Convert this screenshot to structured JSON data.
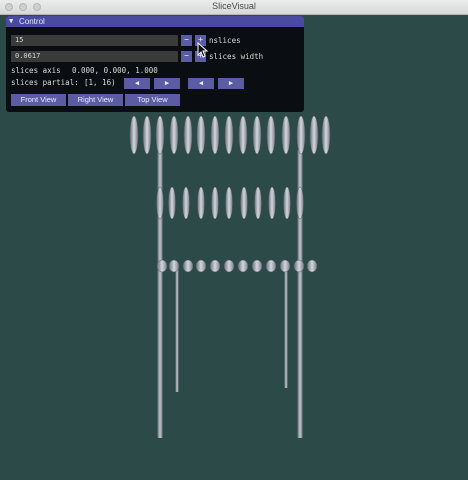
{
  "window": {
    "title": "SliceVisual"
  },
  "panel": {
    "title": "Control",
    "nslices": {
      "value": "15",
      "label": "nslices",
      "minus": "−",
      "plus": "+"
    },
    "slices_width": {
      "value": "0.0617",
      "label": "slices width",
      "minus": "−",
      "plus": "+"
    },
    "slices_axis": {
      "label": "slices axis",
      "value": "0.000, 0.000,  1.000"
    },
    "slices_partial": {
      "label": "slices partial:",
      "value": "[1, 16)",
      "left_arrow": "◀",
      "right_arrow": "▶"
    },
    "views": {
      "front": "Front View",
      "right": "Right View",
      "top": "Top View"
    }
  },
  "colors": {
    "background": "#2b4a48",
    "accent": "#5c5ca4",
    "header": "#4a4aa0"
  },
  "icons": {
    "collapse": "triangle-down-icon",
    "cursor": "mouse-pointer-icon"
  }
}
